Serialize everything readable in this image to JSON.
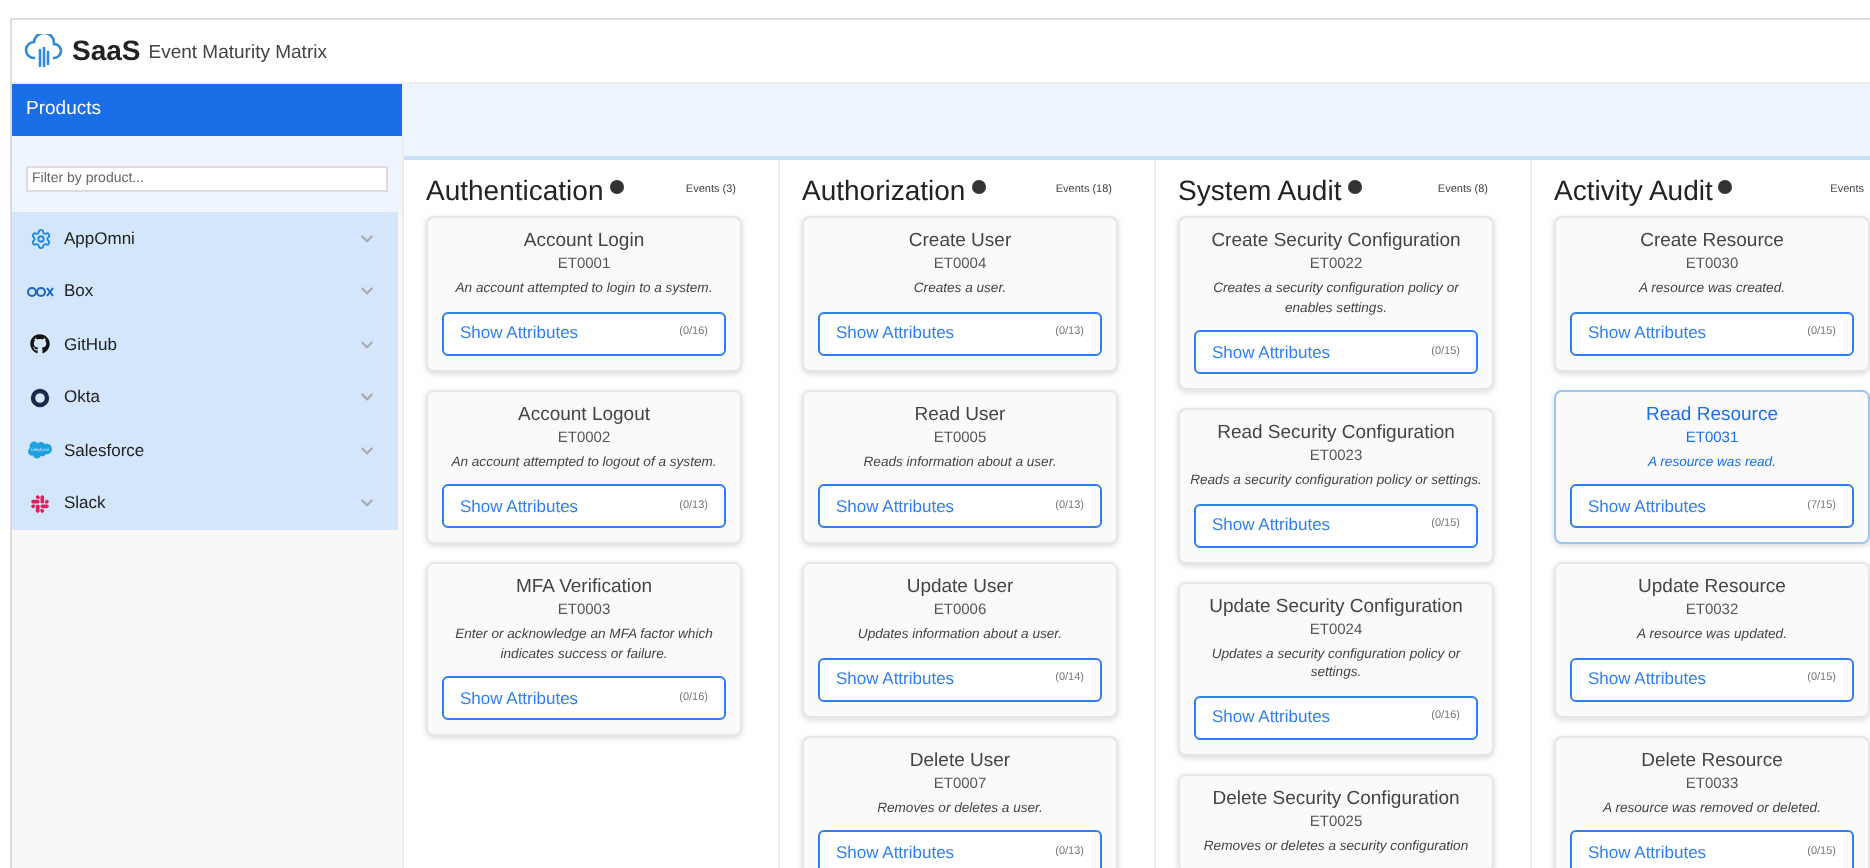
{
  "header": {
    "brand": "SaaS",
    "title": "Event Maturity Matrix"
  },
  "sidebar": {
    "title": "Products",
    "filter": {
      "placeholder": "Filter by product..."
    },
    "items": [
      {
        "label": "AppOmni",
        "kind": "gear",
        "expanded": false
      },
      {
        "label": "Box",
        "kind": "box",
        "expanded": false
      },
      {
        "label": "GitHub",
        "kind": "github",
        "expanded": false
      },
      {
        "label": "Okta",
        "kind": "ring",
        "expanded": false
      },
      {
        "label": "Salesforce",
        "kind": "cloud",
        "expanded": false
      },
      {
        "label": "Slack",
        "kind": "slack",
        "expanded": false
      }
    ]
  },
  "columns": [
    {
      "title": "Authentication",
      "count": "Events (3)",
      "cards": [
        {
          "title": "Account Login",
          "id": "ET0001",
          "description": "An account attempted to login to a system.",
          "button": "Show Attributes",
          "attributes": "(0/16)",
          "selected": false
        },
        {
          "title": "Account Logout",
          "id": "ET0002",
          "description": "An account attempted to logout of a system.",
          "button": "Show Attributes",
          "attributes": "(0/13)",
          "selected": false
        },
        {
          "title": "MFA Verification",
          "id": "ET0003",
          "description": "Enter or acknowledge an MFA factor which indicates success or failure.",
          "button": "Show Attributes",
          "attributes": "(0/16)",
          "selected": false
        }
      ]
    },
    {
      "title": "Authorization",
      "count": "Events (18)",
      "cards": [
        {
          "title": "Create User",
          "id": "ET0004",
          "description": "Creates a user.",
          "button": "Show Attributes",
          "attributes": "(0/13)",
          "selected": false
        },
        {
          "title": "Read User",
          "id": "ET0005",
          "description": "Reads information about a user.",
          "button": "Show Attributes",
          "attributes": "(0/13)",
          "selected": false
        },
        {
          "title": "Update User",
          "id": "ET0006",
          "description": "Updates information about a user.",
          "button": "Show Attributes",
          "attributes": "(0/14)",
          "selected": false
        },
        {
          "title": "Delete User",
          "id": "ET0007",
          "description": "Removes or deletes a user.",
          "button": "Show Attributes",
          "attributes": "(0/13)",
          "selected": false
        }
      ]
    },
    {
      "title": "System Audit",
      "count": "Events (8)",
      "cards": [
        {
          "title": "Create Security Configuration",
          "id": "ET0022",
          "description": "Creates a security configuration policy or enables settings.",
          "button": "Show Attributes",
          "attributes": "(0/15)",
          "selected": false
        },
        {
          "title": "Read Security Configuration",
          "id": "ET0023",
          "description": "Reads a security configuration policy or settings.",
          "button": "Show Attributes",
          "attributes": "(0/15)",
          "selected": false
        },
        {
          "title": "Update Security Configuration",
          "id": "ET0024",
          "description": "Updates a security configuration policy or settings.",
          "button": "Show Attributes",
          "attributes": "(0/16)",
          "selected": false
        },
        {
          "title": "Delete Security Configuration",
          "id": "ET0025",
          "description": "Removes or deletes a security configuration"
        }
      ]
    },
    {
      "title": "Activity Audit",
      "count": "Events",
      "cards": [
        {
          "title": "Create Resource",
          "id": "ET0030",
          "description": "A resource was created.",
          "button": "Show Attributes",
          "attributes": "(0/15)",
          "selected": false
        },
        {
          "title": "Read Resource",
          "id": "ET0031",
          "description": "A resource was read.",
          "button": "Show Attributes",
          "attributes": "(7/15)",
          "selected": true
        },
        {
          "title": "Update Resource",
          "id": "ET0032",
          "description": "A resource was updated.",
          "button": "Show Attributes",
          "attributes": "(0/15)",
          "selected": false
        },
        {
          "title": "Delete Resource",
          "id": "ET0033",
          "description": "A resource was removed or deleted.",
          "button": "Show Attributes",
          "attributes": "(0/15)",
          "selected": false
        }
      ]
    }
  ]
}
